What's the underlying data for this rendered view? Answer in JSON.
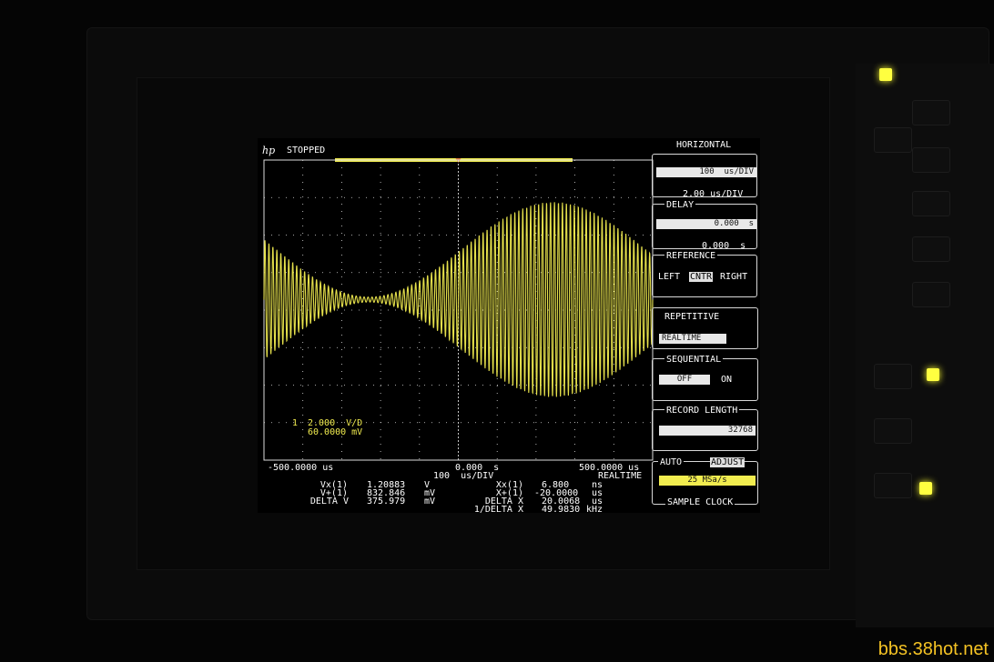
{
  "status": {
    "brand": "hp",
    "state": "STOPPED"
  },
  "channel": {
    "number": "1",
    "scale": "2.000  V/D",
    "offset": "60.0000 mV"
  },
  "timebase": {
    "left": "-500.0000 us",
    "center": "0.000  s",
    "right": "500.0000 us",
    "per_div": "100  us/DIV",
    "mode": "REALTIME"
  },
  "measurements": [
    {
      "label": "Vx(1)",
      "value": "1.20883",
      "unit": "V"
    },
    {
      "label": "V+(1)",
      "value": "832.846",
      "unit": "mV"
    },
    {
      "label": "DELTA V",
      "value": "375.979",
      "unit": "mV"
    },
    {
      "label": "Xx(1)",
      "value": "6.800",
      "unit": "ns"
    },
    {
      "label": "X+(1)",
      "value": "-20.0000",
      "unit": "us"
    },
    {
      "label": "DELTA X",
      "value": "20.0068",
      "unit": "us"
    },
    {
      "label": "1/DELTA X",
      "value": "49.9830",
      "unit": "kHz"
    }
  ],
  "menu": {
    "title": "HORIZONTAL",
    "timebase_field": "100  us/DIV",
    "timebase_value": "2.00 us/DIV",
    "delay_label": "DELAY",
    "delay_field": "0.000  s",
    "delay_value": "0.000  s",
    "reference_label": "REFERENCE",
    "ref_left": "LEFT",
    "ref_center": "CNTR",
    "ref_right": "RIGHT",
    "repetitive_label": "REPETITIVE",
    "repetitive_field": "REALTIME",
    "sequential_label": "SEQUENTIAL",
    "seq_off": "OFF",
    "seq_on": "ON",
    "record_label": "RECORD LENGTH",
    "record_value": "32768",
    "auto_label": "AUTO",
    "adjust_label": "ADJUST",
    "sample_rate": "25 MSa/s",
    "sample_clock_label": "SAMPLE CLOCK"
  },
  "watermark": "bbs.38hot.net",
  "colors": {
    "trace": "#f1ec4f",
    "graticule": "#dcdcdc",
    "background": "#000000"
  }
}
